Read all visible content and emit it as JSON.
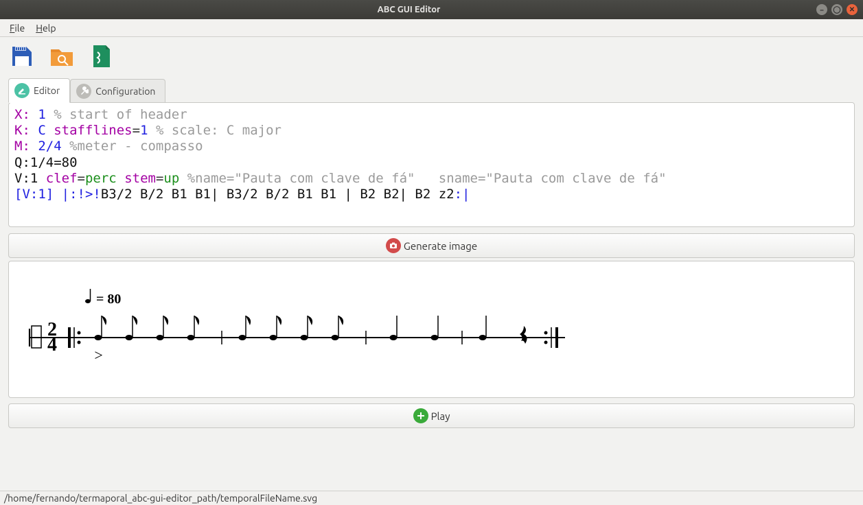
{
  "window": {
    "title": "ABC GUI Editor"
  },
  "menu": {
    "file": "File",
    "help": "Help"
  },
  "tabs": {
    "editor": "Editor",
    "configuration": "Configuration"
  },
  "editor_code": {
    "l1": {
      "a": "X:",
      "b": " 1 ",
      "c": "% start of header"
    },
    "l2": {
      "a": "K:",
      "b": " C ",
      "c": "stafflines",
      "d": "=",
      "e": "1 ",
      "f": "% scale: C major"
    },
    "l3": {
      "a": "M:",
      "b": " 2/4 ",
      "c": "%meter - compasso"
    },
    "l4": {
      "a": "Q:1/4=80"
    },
    "l5": {
      "a": "V:1 ",
      "b": "clef",
      "c": "=",
      "d": "perc ",
      "e": "stem",
      "f": "=",
      "g": "up ",
      "h": "%name=\"Pauta com clave de fá\"   sname=\"Pauta com clave de fá\""
    },
    "l6": {
      "a": "[V:1] |:!>!",
      "b": "B3/2 B/2 B1 B1| B3/2 B/2 B1 B1 | B2 B2| B2 z2",
      "c": ":|"
    }
  },
  "buttons": {
    "generate": "Generate image",
    "play": "Play"
  },
  "score": {
    "tempo": "= 80",
    "timesig_top": "2",
    "timesig_bot": "4",
    "accent": ">"
  },
  "status": {
    "path": "/home/fernando/termaporal_abc-gui-editor_path/temporalFileName.svg"
  }
}
